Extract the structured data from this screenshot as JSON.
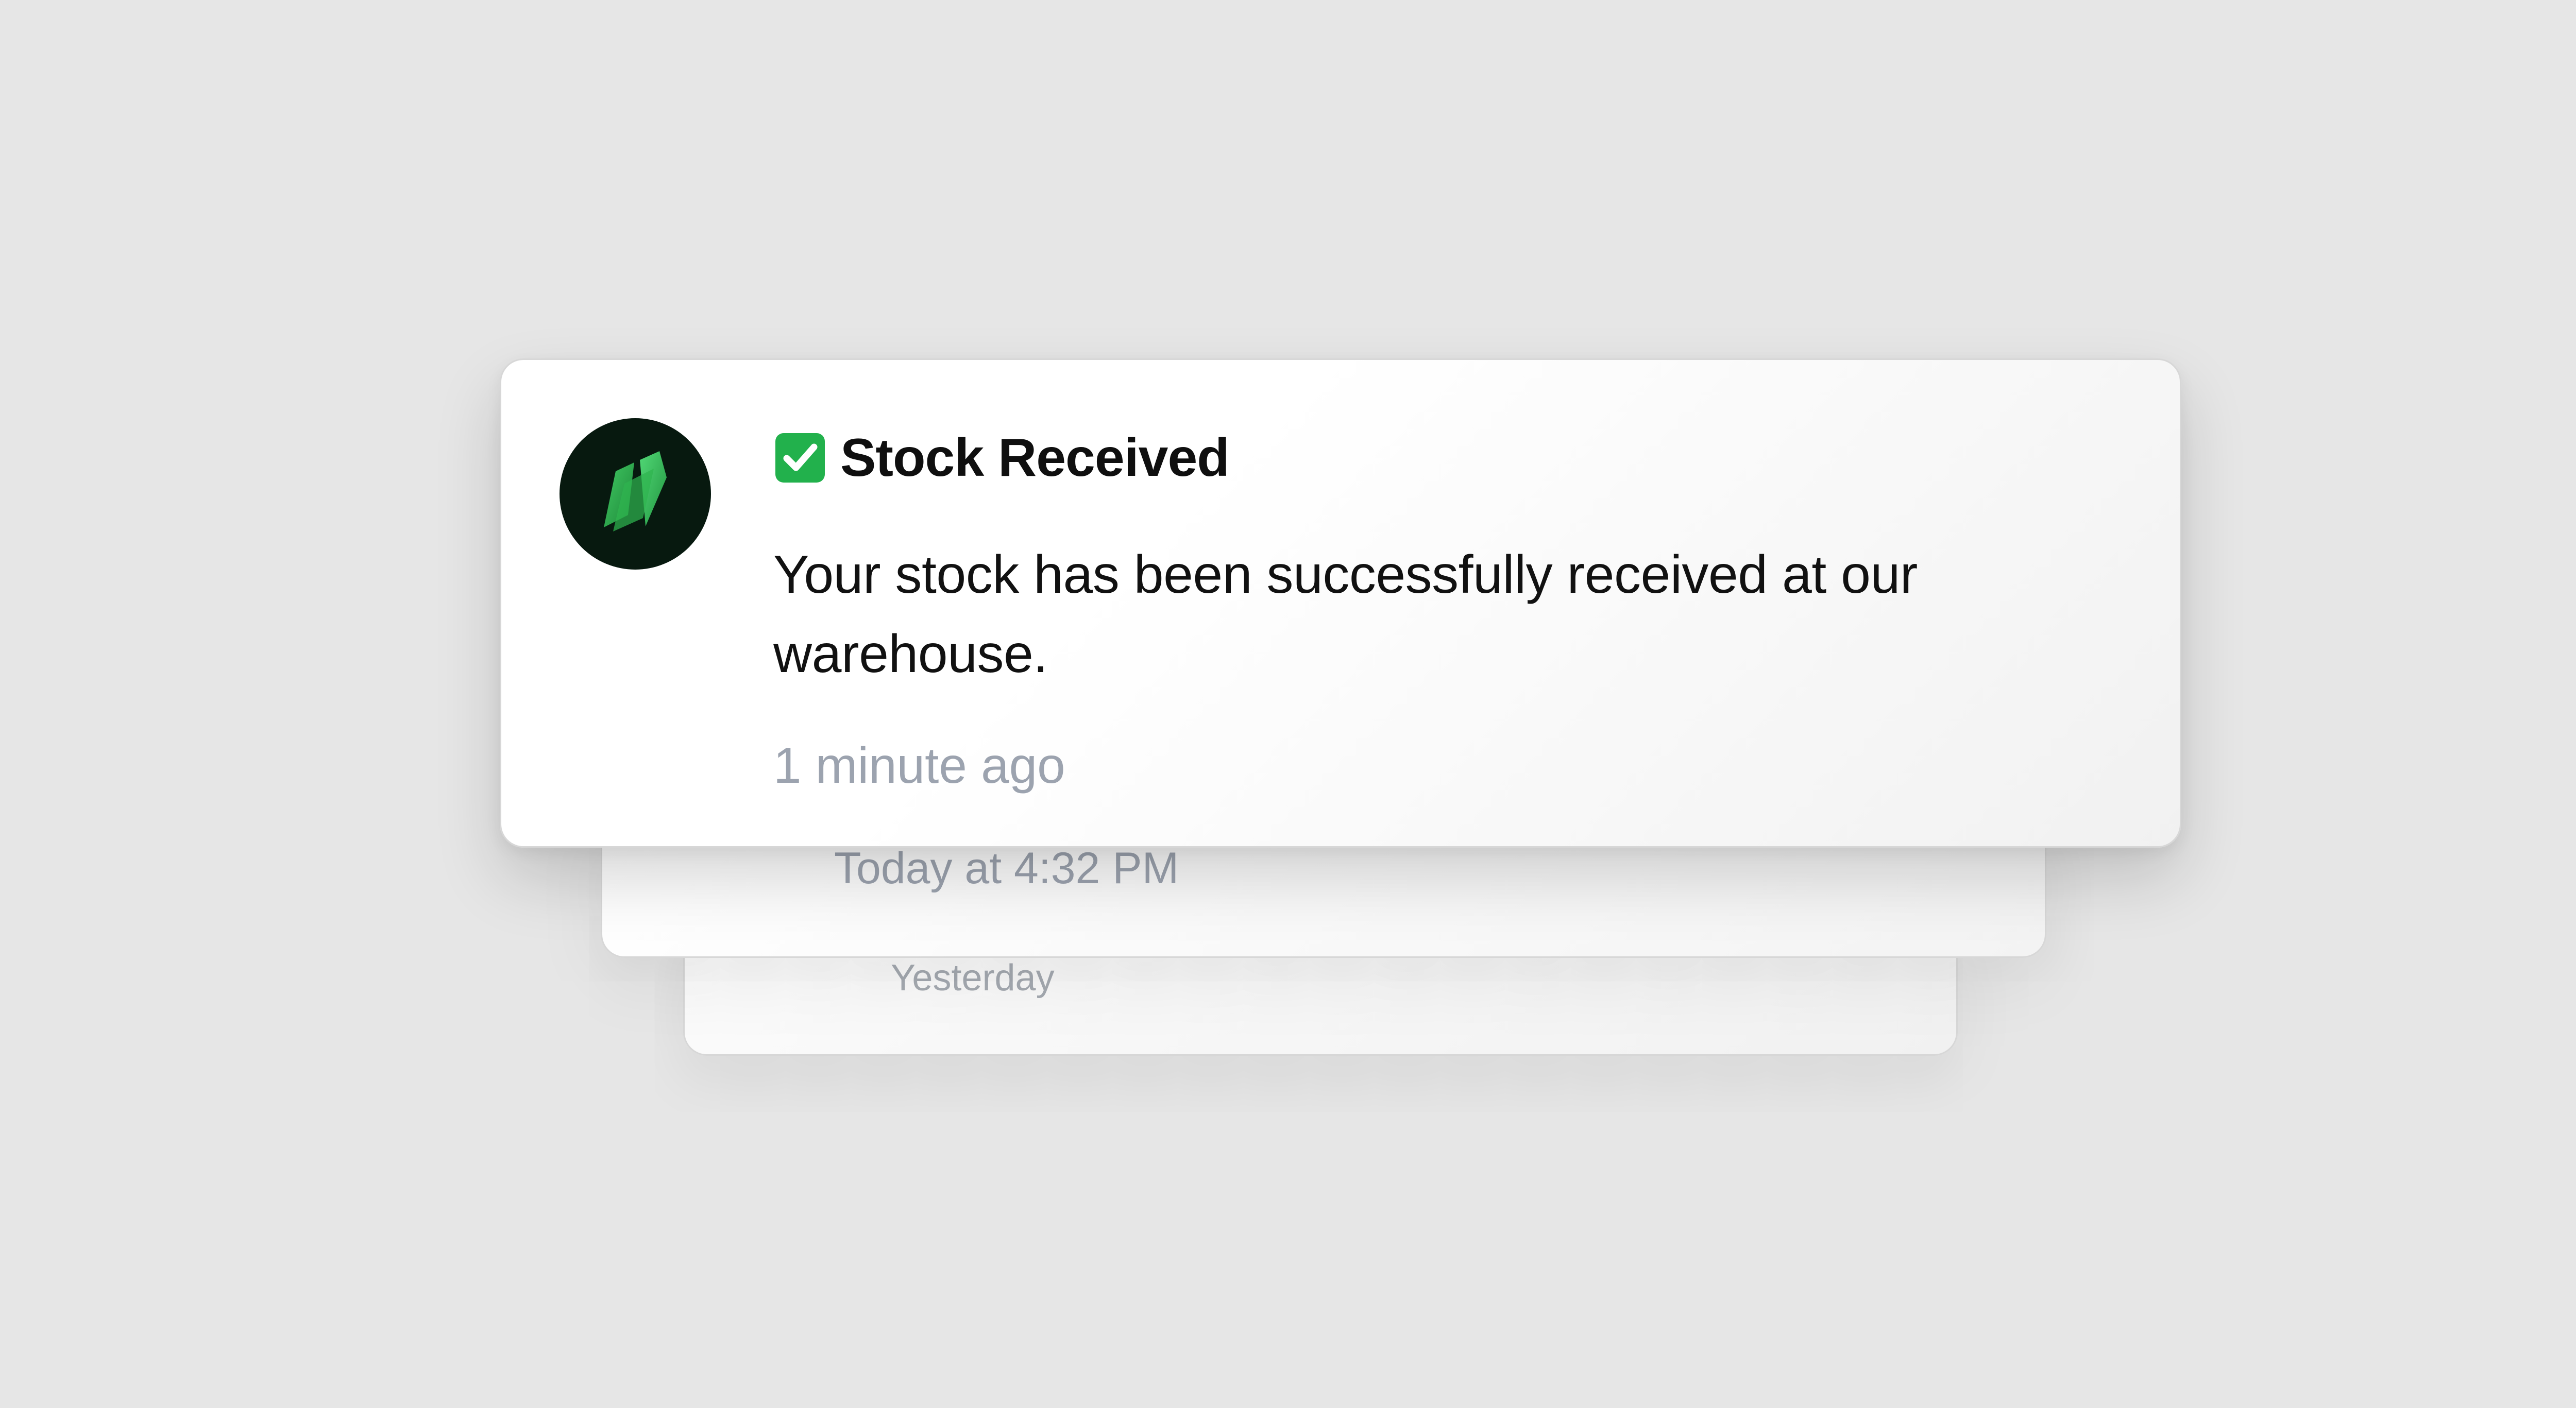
{
  "notifications": [
    {
      "icon": "brand-logo-icon",
      "check_icon": "check-mark-icon",
      "title": "Stock Received",
      "message": "Your stock has been successfully received at our warehouse.",
      "time": "1 minute ago"
    },
    {
      "time": "Today at 4:32 PM"
    },
    {
      "time": "Yesterday"
    }
  ],
  "colors": {
    "background": "#e6e6e6",
    "avatar_bg": "#07190f",
    "logo_green": "#2db34a",
    "check_green": "#22b14c",
    "timestamp_gray": "#9ca3af"
  }
}
